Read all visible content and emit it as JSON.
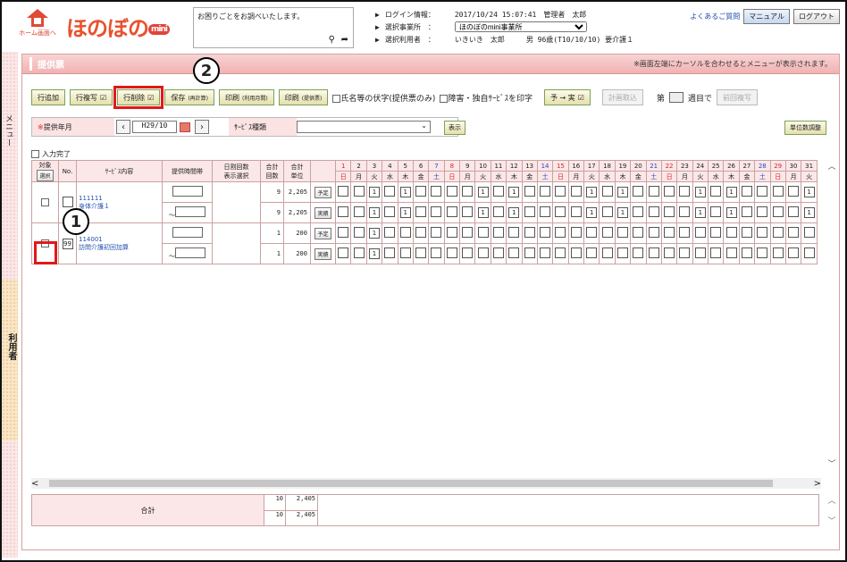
{
  "header": {
    "home_label": "ホーム画面へ",
    "logo_text": "ほのぼの",
    "logo_sub": "mini",
    "search_placeholder": "お困りごとをお調べいたします。",
    "login_label": "ログイン情報：",
    "login_value": "2017/10/24 15:07:41　管理者　太郎",
    "office_label": "選択事業所　：",
    "office_value": "ほのぼのmini事業所",
    "user_label": "選択利用者　：",
    "user_value": "いきいき　太郎　　　男 96歳(T10/10/10) 要介護１",
    "faq_link": "よくあるご質問",
    "manual_button": "マニュアル",
    "logout_button": "ログアウト"
  },
  "sidebar": {
    "menu_tab": "メニュー",
    "user_tab": "利用者"
  },
  "section": {
    "title": "提供票",
    "note": "※画面左端にカーソルを合わせるとメニューが表示されます。"
  },
  "toolbar": {
    "add_row": "行追加",
    "copy_row": "行複写",
    "delete_row": "行削除",
    "save": "保存",
    "save_sub": "(再計算)",
    "print1": "印刷",
    "print1_sub": "(利用月間)",
    "print2": "印刷",
    "print2_sub": "(提供票)",
    "name_opt": "氏名等の伏字(提供票のみ)",
    "disability_opt": "障害・独自ｻｰﾋﾞｽを印字",
    "plan_to_actual": "予 → 実",
    "plan_import": "計画取込",
    "week_prefix": "第",
    "week_suffix": "週目で",
    "prev_week_copy": "前回複写"
  },
  "filter": {
    "month_label": "提供年月",
    "month_value": "H29/10",
    "service_label": "ｻｰﾋﾞｽ種類",
    "show_button": "表示",
    "unit_adjust_button": "単位数調整"
  },
  "input_done_label": "入力完了",
  "table": {
    "headers": {
      "target": "対象",
      "select_btn": "選択",
      "no": "No.",
      "service": "ｻｰﾋﾞｽ内容",
      "time": "提供時間帯",
      "daily1": "日割回数",
      "daily2": "表示選択",
      "count1": "合計",
      "count2": "回数",
      "unit1": "合計",
      "unit2": "単位"
    },
    "days": [
      "1",
      "2",
      "3",
      "4",
      "5",
      "6",
      "7",
      "8",
      "9",
      "10",
      "11",
      "12",
      "13",
      "14",
      "15",
      "16",
      "17",
      "18",
      "19",
      "20",
      "21",
      "22",
      "23",
      "24",
      "25",
      "26",
      "27",
      "28",
      "29",
      "30",
      "31"
    ],
    "weekdays": [
      "日",
      "月",
      "火",
      "水",
      "木",
      "金",
      "土",
      "日",
      "月",
      "火",
      "水",
      "木",
      "金",
      "土",
      "日",
      "月",
      "火",
      "水",
      "木",
      "金",
      "土",
      "日",
      "月",
      "火",
      "水",
      "木",
      "金",
      "土",
      "日",
      "月",
      "火"
    ],
    "tilde": "～",
    "rows": [
      {
        "code": "111111",
        "name": "身体介護１",
        "no": "",
        "plan_count": "9",
        "plan_units": "2,205",
        "actual_count": "9",
        "actual_units": "2,205",
        "plan_btn": "予定",
        "actual_btn": "実績",
        "plan_days": [
          "",
          "",
          "1",
          "",
          "1",
          "",
          "",
          "",
          "",
          "1",
          "",
          "1",
          "",
          "",
          "",
          "",
          "1",
          "",
          "1",
          "",
          "",
          "",
          "",
          "1",
          "",
          "1",
          "",
          "",
          "",
          "",
          "1"
        ],
        "actual_days": [
          "",
          "",
          "1",
          "",
          "1",
          "",
          "",
          "",
          "",
          "1",
          "",
          "1",
          "",
          "",
          "",
          "",
          "1",
          "",
          "1",
          "",
          "",
          "",
          "",
          "1",
          "",
          "1",
          "",
          "",
          "",
          "",
          "1"
        ]
      },
      {
        "code": "114001",
        "name": "訪問介護初回加算",
        "no": "99",
        "plan_count": "1",
        "plan_units": "200",
        "actual_count": "1",
        "actual_units": "200",
        "plan_btn": "予定",
        "actual_btn": "実績",
        "plan_days": [
          "",
          "",
          "1",
          "",
          "",
          "",
          "",
          "",
          "",
          "",
          "",
          "",
          "",
          "",
          "",
          "",
          "",
          "",
          "",
          "",
          "",
          "",
          "",
          "",
          "",
          "",
          "",
          "",
          "",
          "",
          ""
        ],
        "actual_days": [
          "",
          "",
          "1",
          "",
          "",
          "",
          "",
          "",
          "",
          "",
          "",
          "",
          "",
          "",
          "",
          "",
          "",
          "",
          "",
          "",
          "",
          "",
          "",
          "",
          "",
          "",
          "",
          "",
          "",
          "",
          ""
        ]
      }
    ]
  },
  "total": {
    "label": "合計",
    "count1": "10",
    "units1": "2,405",
    "count2": "10",
    "units2": "2,405"
  },
  "callouts": {
    "one": "1",
    "two": "2"
  }
}
